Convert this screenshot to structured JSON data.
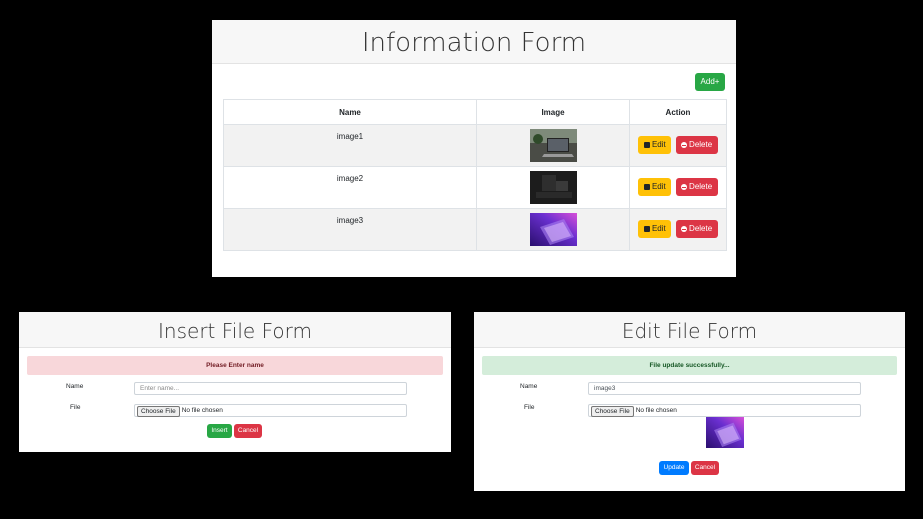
{
  "main": {
    "title": "Information Form",
    "add_label": "Add+",
    "columns": [
      "Name",
      "Image",
      "Action"
    ],
    "rows": [
      {
        "name": "image1",
        "thumb_colors": [
          "#3d3f3a",
          "#8e9a8b"
        ]
      },
      {
        "name": "image2",
        "thumb_colors": [
          "#1b1b1b",
          "#3a3a3a"
        ]
      },
      {
        "name": "image3",
        "thumb_colors": [
          "#3b1a8c",
          "#c94fd6"
        ]
      }
    ],
    "edit_label": "Edit",
    "delete_label": "Delete"
  },
  "insert_form": {
    "title": "Insert File Form",
    "alert": "Please Enter name",
    "name_label": "Name",
    "name_placeholder": "Enter name...",
    "file_label": "File",
    "choose_label": "Choose File",
    "no_file": "No file chosen",
    "insert_label": "Insert",
    "cancel_label": "Cancel"
  },
  "edit_form": {
    "title": "Edit File Form",
    "alert": "File update successfully...",
    "name_label": "Name",
    "name_value": "image3",
    "file_label": "File",
    "choose_label": "Choose File",
    "no_file": "No file chosen",
    "update_label": "Update",
    "cancel_label": "Cancel"
  },
  "colors": {
    "success": "#28a745",
    "danger": "#dc3545",
    "warning": "#ffc107",
    "primary": "#007bff"
  }
}
